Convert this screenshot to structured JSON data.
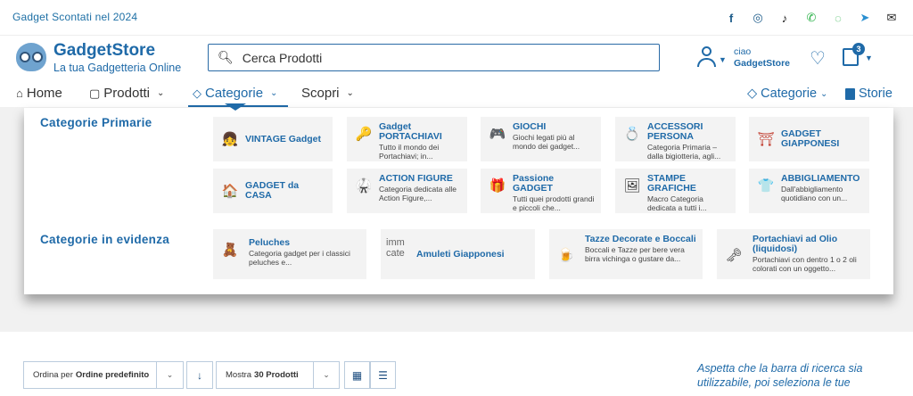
{
  "topbar": {
    "promo": "Gadget Scontati nel 2024",
    "socials": [
      {
        "icon": "facebook-icon",
        "glyph": "f"
      },
      {
        "icon": "instagram-icon",
        "glyph": "◎"
      },
      {
        "icon": "tiktok-icon",
        "glyph": "♪"
      },
      {
        "icon": "wechat-icon",
        "glyph": "✆"
      },
      {
        "icon": "whatsapp-icon",
        "glyph": "◌"
      },
      {
        "icon": "telegram-icon",
        "glyph": "➤"
      },
      {
        "icon": "email-icon",
        "glyph": "✉"
      }
    ]
  },
  "header": {
    "brand": "GadgetStore",
    "tagline": "La tua Gadgetteria Online",
    "search_placeholder": "Cerca Prodotti",
    "greeting": "ciao",
    "username": "GadgetStore",
    "cart_count": "3"
  },
  "nav": {
    "home": "Home",
    "prodotti": "Prodotti",
    "categorie": "Categorie",
    "scopri": "Scopri",
    "right_categorie": "Categorie",
    "storie": "Storie"
  },
  "mega": {
    "primary_title": "Categorie Primarie",
    "featured_title": "Categorie in evidenza",
    "primary": [
      {
        "title": "VINTAGE Gadget",
        "desc": "",
        "icon": "👧"
      },
      {
        "title": "Gadget PORTACHIAVI",
        "desc": "Tutto il mondo dei Portachiavi; in...",
        "icon": "🔑"
      },
      {
        "title": "GIOCHI",
        "desc": "Giochi legati più al mondo dei gadget...",
        "icon": "🎮"
      },
      {
        "title": "ACCESSORI PERSONA",
        "desc": "Categoria Primaria – dalla bigiotteria, agli...",
        "icon": "💍"
      },
      {
        "title": "GADGET GIAPPONESI",
        "desc": "",
        "icon": "⛩"
      },
      {
        "title": "GADGET da CASA",
        "desc": "",
        "icon": "🏠"
      },
      {
        "title": "ACTION FIGURE",
        "desc": "Categoria dedicata alle Action Figure,...",
        "icon": "🥋"
      },
      {
        "title": "Passione GADGET",
        "desc": "Tutti quei prodotti grandi e piccoli che...",
        "icon": "🎁"
      },
      {
        "title": "STAMPE GRAFICHE",
        "desc": "Macro Categoria dedicata a tutti i...",
        "icon": "🖼"
      },
      {
        "title": "ABBIGLIAMENTO",
        "desc": "Dall'abbigliamento quotidiano con un...",
        "icon": "👕"
      }
    ],
    "featured": [
      {
        "title": "Peluches",
        "desc": "Categoria gadget per i classici peluches e...",
        "icon": "🧸"
      },
      {
        "title": "Amuleti Giapponesi",
        "desc": "",
        "icon": "",
        "alt": "imm cate"
      },
      {
        "title": "Tazze Decorate e Boccali",
        "desc": "Boccali e Tazze per bere vera birra vichinga o gustare da...",
        "icon": "🍺"
      },
      {
        "title": "Portachiavi ad Olio (liquidosi)",
        "desc": "Portachiavi con dentro 1 o 2 oli colorati con un oggetto...",
        "icon": "🗝"
      }
    ]
  },
  "toolbar": {
    "order_prefix": "Ordina per",
    "order_value": "Ordine predefinito",
    "show_prefix": "Mostra",
    "show_value": "30 Prodotti",
    "side_note": "Aspetta che la barra di ricerca sia utilizzabile, poi seleziona le tue"
  }
}
